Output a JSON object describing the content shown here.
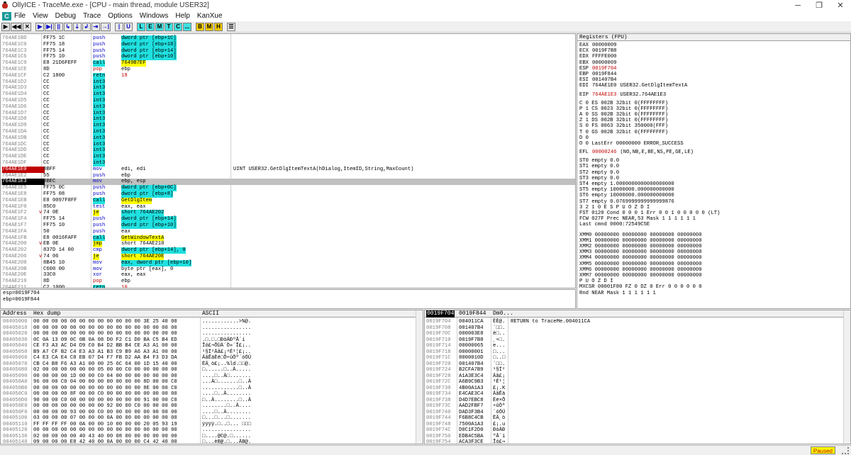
{
  "window": {
    "title": "OllyICE - TraceMe.exe - [CPU - main thread, module USER32]",
    "controls": [
      "─",
      "❐",
      "✕"
    ]
  },
  "menu": {
    "logo": "C",
    "items": [
      "File",
      "View",
      "Debug",
      "Trace",
      "Options",
      "Windows",
      "Help",
      "KanXue"
    ]
  },
  "toolbar": {
    "group1": [
      "▶",
      "◀◀",
      "✕"
    ],
    "group2": [
      "▶",
      "▶|",
      "||",
      "↳",
      "⇣",
      "↲",
      "⇥",
      "→|"
    ],
    "group3": [
      "|",
      "U"
    ],
    "group4": [
      "L",
      "E",
      "M",
      "T",
      "C",
      "..."
    ],
    "group5": [
      "B",
      "M",
      "H"
    ],
    "group6": [
      "☰"
    ]
  },
  "disasm": [
    {
      "addr": "764AE1BD",
      "hex": "FF75 1C",
      "mn": "push",
      "op": "dword ptr [ebp+1C]",
      "opc": "cyan"
    },
    {
      "addr": "764AE1C0",
      "hex": "FF75 18",
      "mn": "push",
      "op": "dword ptr [ebp+18]",
      "opc": "cyan"
    },
    {
      "addr": "764AE1C3",
      "hex": "FF75 14",
      "mn": "push",
      "op": "dword ptr [ebp+14]",
      "opc": "cyan"
    },
    {
      "addr": "764AE1C6",
      "hex": "FF75 10",
      "mn": "push",
      "op": "dword ptr [ebp+10]",
      "opc": "cyan"
    },
    {
      "addr": "764AE1C9",
      "hex": "E8 21D6FEFF",
      "mn": "call",
      "op": "7649B7EF",
      "opc": "yellow",
      "mnc": "cyan"
    },
    {
      "addr": "764AE1CE",
      "hex": "8D",
      "mn": "pop",
      "op": "ebp",
      "mnc": "red"
    },
    {
      "addr": "764AE1CF",
      "hex": "C2 1800",
      "mn": "retn",
      "op": "18",
      "mnc": "cyan",
      "opr": "red"
    },
    {
      "addr": "764AE1D2",
      "hex": "CC",
      "mn": "int3",
      "mnc": "cyan"
    },
    {
      "addr": "764AE1D3",
      "hex": "CC",
      "mn": "int3",
      "mnc": "cyan"
    },
    {
      "addr": "764AE1D4",
      "hex": "CC",
      "mn": "int3",
      "mnc": "cyan"
    },
    {
      "addr": "764AE1D5",
      "hex": "CC",
      "mn": "int3",
      "mnc": "cyan"
    },
    {
      "addr": "764AE1D6",
      "hex": "CC",
      "mn": "int3",
      "mnc": "cyan"
    },
    {
      "addr": "764AE1D7",
      "hex": "CC",
      "mn": "int3",
      "mnc": "cyan"
    },
    {
      "addr": "764AE1D8",
      "hex": "CC",
      "mn": "int3",
      "mnc": "cyan"
    },
    {
      "addr": "764AE1D9",
      "hex": "CC",
      "mn": "int3",
      "mnc": "cyan"
    },
    {
      "addr": "764AE1DA",
      "hex": "CC",
      "mn": "int3",
      "mnc": "cyan"
    },
    {
      "addr": "764AE1DB",
      "hex": "CC",
      "mn": "int3",
      "mnc": "cyan"
    },
    {
      "addr": "764AE1DC",
      "hex": "CC",
      "mn": "int3",
      "mnc": "cyan"
    },
    {
      "addr": "764AE1DD",
      "hex": "CC",
      "mn": "int3",
      "mnc": "cyan"
    },
    {
      "addr": "764AE1DE",
      "hex": "CC",
      "mn": "int3",
      "mnc": "cyan"
    },
    {
      "addr": "764AE1DF",
      "hex": "CC",
      "mn": "int3",
      "mnc": "cyan"
    },
    {
      "addr": "764AE1E0",
      "hex": "8BFF",
      "mn": "mov",
      "op": "edi, edi",
      "cm": "UINT USER32.GetDlgItemTextA(hDialog,ItemID,String,MaxCount)",
      "ac": "eip"
    },
    {
      "addr": "764AE1E2",
      "hex": "55",
      "mn": "push",
      "op": "ebp"
    },
    {
      "addr": "764AE1E3",
      "hex": "8BEC",
      "mn": "mov",
      "op": "ebp, esp",
      "ac": "cur",
      "sel": true
    },
    {
      "addr": "764AE1E5",
      "hex": "FF75 0C",
      "mn": "push",
      "op": "dword ptr [ebp+0C]",
      "opc": "cyan"
    },
    {
      "addr": "764AE1E8",
      "hex": "FF75 08",
      "mn": "push",
      "op": "dword ptr [ebp+8]",
      "opc": "cyan"
    },
    {
      "addr": "764AE1EB",
      "hex": "E8 0097F8FF",
      "mn": "call",
      "op": "GetDlgItem",
      "opc": "yellow",
      "mnc": "cyan"
    },
    {
      "addr": "764AE1F0",
      "hex": "85C0",
      "mn": "test",
      "op": "eax, eax"
    },
    {
      "addr": "764AE1F2",
      "hex": "74 0E",
      "mk": "v",
      "mn": "je",
      "op": "short 764AE202",
      "opc": "cyan",
      "mnc": "yellow"
    },
    {
      "addr": "764AE1F4",
      "hex": "FF75 14",
      "mn": "push",
      "op": "dword ptr [ebp+14]",
      "opc": "cyan"
    },
    {
      "addr": "764AE1F7",
      "hex": "FF75 10",
      "mn": "push",
      "op": "dword ptr [ebp+10]",
      "opc": "cyan"
    },
    {
      "addr": "764AE1FA",
      "hex": "50",
      "mn": "push",
      "op": "eax"
    },
    {
      "addr": "764AE1FB",
      "hex": "E8 0016FAFF",
      "mn": "call",
      "op": "GetWindowTextA",
      "opc": "yellow",
      "mnc": "cyan"
    },
    {
      "addr": "764AE200",
      "hex": "EB 0E",
      "mk": "v",
      "mn": "jmp",
      "op": "short 764AE210",
      "mnc": "yellow"
    },
    {
      "addr": "764AE202",
      "hex": "837D 14 00",
      "mn": "cmp",
      "op": "dword ptr [ebp+14], 0",
      "opc": "cyan"
    },
    {
      "addr": "764AE206",
      "hex": "74 06",
      "mk": "v",
      "mn": "je",
      "op": "short 764AE20E",
      "opc": "yellow",
      "mnc": "yellow"
    },
    {
      "addr": "764AE208",
      "hex": "8B45 10",
      "mn": "mov",
      "op": "eax, dword ptr [ebp+10]",
      "opc": "cyan"
    },
    {
      "addr": "764AE20B",
      "hex": "C600 00",
      "mn": "mov",
      "op": "byte ptr [eax], 0"
    },
    {
      "addr": "764AE20E",
      "hex": "33C0",
      "mn": "xor",
      "op": "eax, eax"
    },
    {
      "addr": "764AE210",
      "hex": "8D",
      "mn": "pop",
      "op": "ebp",
      "mnc": "red"
    },
    {
      "addr": "764AE211",
      "hex": "C2 1000",
      "mn": "retn",
      "op": "10",
      "mnc": "cyan",
      "opr": "red"
    },
    {
      "addr": "764AE214",
      "hex": "CC",
      "mn": "int3",
      "mnc": "cyan"
    }
  ],
  "info": [
    "esp=0019F704",
    "ebp=0019F844"
  ],
  "registers": {
    "header": "Registers (FPU)",
    "gp": [
      {
        "n": "EAX",
        "v": "00000009"
      },
      {
        "n": "ECX",
        "v": "0019F7B8"
      },
      {
        "n": "EDX",
        "v": "FFFFE000"
      },
      {
        "n": "EBX",
        "v": "00000009"
      },
      {
        "n": "ESP",
        "v": "0019F704",
        "red": true
      },
      {
        "n": "EBP",
        "v": "0019F844"
      },
      {
        "n": "ESI",
        "v": "001407B4"
      },
      {
        "n": "EDI",
        "v": "764AE1E0",
        "extra": "USER32.GetDlgItemTextA"
      }
    ],
    "eip": {
      "n": "EIP",
      "v": "764AE1E3",
      "extra": "USER32.764AE1E3"
    },
    "flags": [
      "C 0  ES 002B 32bit 0(FFFFFFFF)",
      "P 1  CS 0023 32bit 0(FFFFFFFF)",
      "A 0  SS 002B 32bit 0(FFFFFFFF)",
      "Z 1  DS 002B 32bit 0(FFFFFFFF)",
      "S 0  FS 0063 32bit 350000(FFF)",
      "T 0  GS 002B 32bit 0(FFFFFFFF)",
      "D 0",
      "O 0  LastErr 00000000 ERROR_SUCCESS"
    ],
    "efl": {
      "n": "EFL",
      "v": "00000246",
      "extra": "(NO,NB,E,BE,NS,PE,GE,LE)"
    },
    "fpu": [
      "ST0 empty 0.0",
      "ST1 empty 0.0",
      "ST2 empty 0.0",
      "ST3 empty 0.0",
      "ST4 empty 1.0000000000000000000",
      "ST5 empty 10000000.000000000000",
      "ST6 empty 10000000.000000000000",
      "ST7 empty 0.0769999999999999876",
      "               3 2 1 0      E S P U O Z D I",
      "FST 0120  Cond 0 0 0 1  Err 0 0 1 0 0 0 0 0  (LT)",
      "FCW 027F  Prec NEAR,53  Mask    1 1 1 1 1 1",
      "Last cmnd 0000:72549C5E"
    ],
    "xmm": [
      "XMM0 00000000 00000000 00000000 00000000",
      "XMM1 00000000 00000000 00000000 00000000",
      "XMM2 00000000 00000000 00000000 00000000",
      "XMM3 00000000 00000000 00000000 00000000",
      "XMM4 00000000 00000000 00000000 00000000",
      "XMM5 00000000 00000000 00000000 00000000",
      "XMM6 00000000 00000000 00000000 00000000",
      "XMM7 00000000 00000000 00000000 00000000",
      "                                P U O Z D I",
      "MXCSR 00001F80  FZ 0 DZ 0  Err  0 0 0 0 0 0",
      "                Rnd NEAR   Mask 1 1 1 1 1 1"
    ]
  },
  "dump": {
    "headers": [
      "Address",
      "Hex dump",
      "ASCII"
    ],
    "rows": [
      {
        "a": "00405000",
        "h": "00 00 00 00 00 00 00 00 00 00 00 00 3E 25 40 00",
        "t": "............>%@."
      },
      {
        "a": "00405010",
        "h": "00 00 00 00 00 00 00 00 00 00 00 00 00 00 00 00",
        "t": "................"
      },
      {
        "a": "00405020",
        "h": "00 00 00 00 00 00 00 00 00 00 00 00 00 00 00 00",
        "t": "................"
      },
      {
        "a": "00405030",
        "h": "0C 0A 13 09 0C 0B 0A 08 D0 F2 C1 D0 BA C5 B4 ED",
        "t": ".□.□.□ÐòÁÐºÅ´í"
      },
      {
        "a": "00405040",
        "h": "CE F3 A3 AC D4 D9 C0 B4 D2 BB B4 CE A3 A1 00 00",
        "t": "Îó£¬ÔÙÀ´Ò»´Î£¡.."
      },
      {
        "a": "00405050",
        "h": "B9 A7 CF B2 C4 E3 A3 A1 B3 C9 B9 A6 A3 A1 00 00",
        "t": "¹§Ï²Äã£¡³É¹¦£¡.."
      },
      {
        "a": "00405060",
        "h": "C4 E3 CA E4 C8 EB 07 D4 F7 FB D2 AA B4 F3 D3 DA",
        "t": "ÄãÊäÈë□Ô÷ûÒª´óÓÚ"
      },
      {
        "a": "00405070",
        "h": "CB C4 B8 F6 A3 A1 00 00 25 6C 64 00 1D 15 40 00",
        "t": "ËÄ¸ö£¡..%ld.□□@."
      },
      {
        "a": "00405080",
        "h": "02 00 00 00 00 00 00 05 00 00 C0 00 00 00 00 00",
        "t": "□......□..À....."
      },
      {
        "a": "00405090",
        "h": "00 00 00 00 1D 00 00 C0 04 00 00 00 00 00 00 00",
        "t": "....□..À□......."
      },
      {
        "a": "004050A0",
        "h": "96 00 00 C0 04 00 00 00 00 00 00 00 8D 00 00 C0",
        "t": "...À□.......□..À"
      },
      {
        "a": "004050B0",
        "h": "00 00 00 00 00 00 00 00 00 00 00 00 8E 00 00 C0",
        "t": "............□..À"
      },
      {
        "a": "004050C0",
        "h": "00 00 00 00 8F 00 00 C0 00 00 00 00 00 00 00 00",
        "t": "....□..À........"
      },
      {
        "a": "004050D0",
        "h": "90 00 00 C0 00 00 00 00 00 00 00 00 91 00 00 C0",
        "t": "□..À........□..À"
      },
      {
        "a": "004050E0",
        "h": "00 00 00 00 00 00 00 00 92 00 00 C0 00 00 00 00",
        "t": "........□..À...."
      },
      {
        "a": "004050F0",
        "h": "00 00 00 00 93 00 00 C0 00 00 00 00 00 00 00 00",
        "t": "....□..À........"
      },
      {
        "a": "00405100",
        "h": "03 00 00 00 07 00 00 00 0A 00 00 00 00 00 00 00",
        "t": "□...□...□......."
      },
      {
        "a": "00405110",
        "h": "FF FF FF FF 00 0A 00 00 10 00 00 00 20 05 93 19",
        "t": "ÿÿÿÿ.□..□... □□□"
      },
      {
        "a": "00405120",
        "h": "00 00 00 00 00 00 00 00 00 00 00 00 00 00 00 00",
        "t": "................"
      },
      {
        "a": "00405130",
        "h": "02 00 00 00 00 40 43 40 00 08 00 00 00 00 00 00",
        "t": "□....@C@.□......"
      },
      {
        "a": "00405140",
        "h": "09 00 00 00 E8 42 40 00 0A 00 00 00 C4 42 40 00",
        "t": "□...èB@.□...ÄB@."
      }
    ]
  },
  "stack": {
    "headers": [
      "0019F704",
      "0019F844",
      "Dm0..."
    ],
    "rows": [
      {
        "a": "0019F704",
        "v": "004011CA",
        "t": "ÈÈ@.",
        "c": "RETURN to TraceMe.004011CA"
      },
      {
        "a": "0019F708",
        "v": "001407B4",
        "t": "´□□.",
        "c": ""
      },
      {
        "a": "0019F70C",
        "v": "000003E8",
        "t": "è□..",
        "c": ""
      },
      {
        "a": "0019F710",
        "v": "0019F7B8",
        "t": "¸÷□.",
        "c": ""
      },
      {
        "a": "0019F714",
        "v": "00000065",
        "t": "e...",
        "c": ""
      },
      {
        "a": "0019F718",
        "v": "00000001",
        "t": "□...",
        "c": ""
      },
      {
        "a": "0019F71C",
        "v": "8000010D",
        "t": "□..□",
        "c": ""
      },
      {
        "a": "0019F720",
        "v": "001407B4",
        "t": "´□□.",
        "c": ""
      },
      {
        "a": "0019F724",
        "v": "B2CFA7B9",
        "t": "¹§Ï²",
        "c": ""
      },
      {
        "a": "0019F728",
        "v": "A1A3E3C4",
        "t": "Äã£¡",
        "c": ""
      },
      {
        "a": "0019F72C",
        "v": "A6B9C9B3",
        "t": "³É¹¦",
        "c": ""
      },
      {
        "a": "0019F730",
        "v": "4B00A1A3",
        "t": "£¡.K",
        "c": ""
      },
      {
        "a": "0019F734",
        "v": "E4CAE3C4",
        "t": "ÄãÊä",
        "c": ""
      },
      {
        "a": "0019F738",
        "v": "D4D7EBC8",
        "t": "Èë×Ô",
        "c": ""
      },
      {
        "a": "0019F73C",
        "v": "AAD2FBF7",
        "t": "÷ûÒª",
        "c": ""
      },
      {
        "a": "0019F740",
        "v": "DAD3F3B4",
        "t": "´óÓÚ",
        "c": ""
      },
      {
        "a": "0019F744",
        "v": "F6B8C4CB",
        "t": "ËÄ¸ö",
        "c": ""
      },
      {
        "a": "0019F748",
        "v": "7500A1A3",
        "t": "£¡.u",
        "c": ""
      },
      {
        "a": "0019F74C",
        "v": "D0C1F2D0",
        "t": "ÐòÁÐ",
        "c": ""
      },
      {
        "a": "0019F750",
        "v": "EDB4C5BA",
        "t": "ºÅ´í",
        "c": ""
      },
      {
        "a": "0019F754",
        "v": "ACA3F3CE",
        "t": "Îó£¬",
        "c": ""
      }
    ]
  },
  "status": {
    "paused": "Paused"
  }
}
